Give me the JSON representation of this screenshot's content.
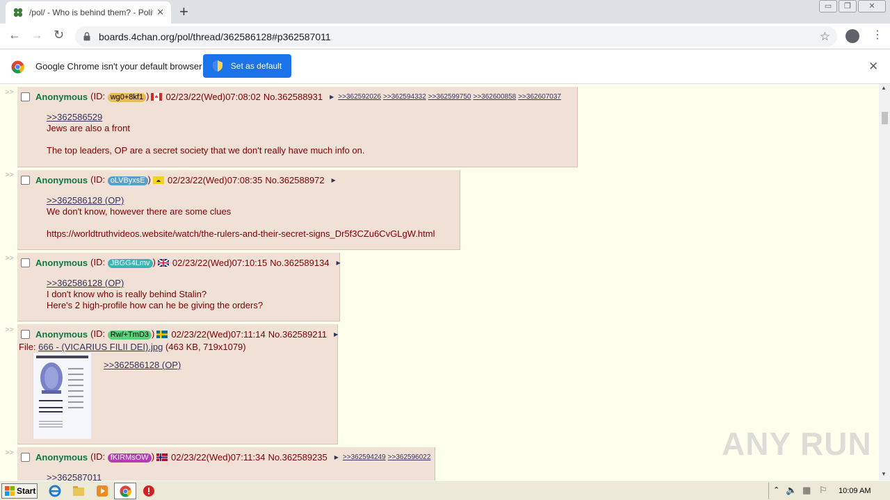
{
  "browser": {
    "tab_title": "/pol/ - Who is behind them? - Politica",
    "url": "boards.4chan.org/pol/thread/362586128#p362587011"
  },
  "infobar": {
    "message": "Google Chrome isn't your default browser",
    "button_label": "Set as default"
  },
  "posts": [
    {
      "name": "Anonymous",
      "id_prefix": "(ID: ",
      "uid": "wg0+8kf1",
      "uid_color": "#e8b95a",
      "id_suffix": ")",
      "datetime": "02/23/22(Wed)07:08:02",
      "number": "No.362588931",
      "backlinks": [
        ">>362592026",
        ">>362594332",
        ">>362599750",
        ">>362600858",
        ">>362607037"
      ],
      "quote": ">>362586529",
      "lines": [
        "Jews are also a front",
        "",
        "The top leaders, OP are a secret society that we don't really have much info on."
      ]
    },
    {
      "name": "Anonymous",
      "id_prefix": "(ID: ",
      "uid": "oLVByxsE",
      "uid_color": "#5a9fc8",
      "id_suffix": ")",
      "datetime": "02/23/22(Wed)07:08:35",
      "number": "No.362588972",
      "backlinks": [],
      "quote": ">>362586128 (OP)",
      "lines": [
        "We don't know, however there are some clues",
        "",
        "https://worldtruthvideos.website/watch/the-rulers-and-their-secret-signs_Dr5f3CZu6CvGLgW.html"
      ]
    },
    {
      "name": "Anonymous",
      "id_prefix": "(ID: ",
      "uid": "JBGG4Lmv",
      "uid_color": "#3cb4b4",
      "id_suffix": ")",
      "datetime": "02/23/22(Wed)07:10:15",
      "number": "No.362589134",
      "backlinks": [],
      "quote": ">>362586128 (OP)",
      "lines": [
        "I don't know who is really behind Stalin?",
        "Here's 2 high-profile how can he be giving the orders?"
      ]
    },
    {
      "name": "Anonymous",
      "id_prefix": "(ID: ",
      "uid": "Rw/+TmD3",
      "uid_color": "#5ad27a",
      "id_suffix": ")",
      "datetime": "02/23/22(Wed)07:11:14",
      "number": "No.362589211",
      "backlinks": [],
      "file_label": "File: ",
      "file_name": "666 - (VICARIUS FILII DEI).jpg",
      "file_meta": "(463 KB, 719x1079)",
      "quote": ">>362586128 (OP)",
      "lines": []
    },
    {
      "name": "Anonymous",
      "id_prefix": "(ID: ",
      "uid": "fKIRMsOW",
      "uid_color": "#b43cb4",
      "id_suffix": ")",
      "datetime": "02/23/22(Wed)07:11:34",
      "number": "No.362589235",
      "backlinks": [
        ">>362594249",
        ">>362596022"
      ],
      "quote": ">>362587011",
      "lines": []
    }
  ],
  "taskbar": {
    "start_label": "Start",
    "clock": "10:09 AM"
  },
  "watermark": "ANY RUN"
}
